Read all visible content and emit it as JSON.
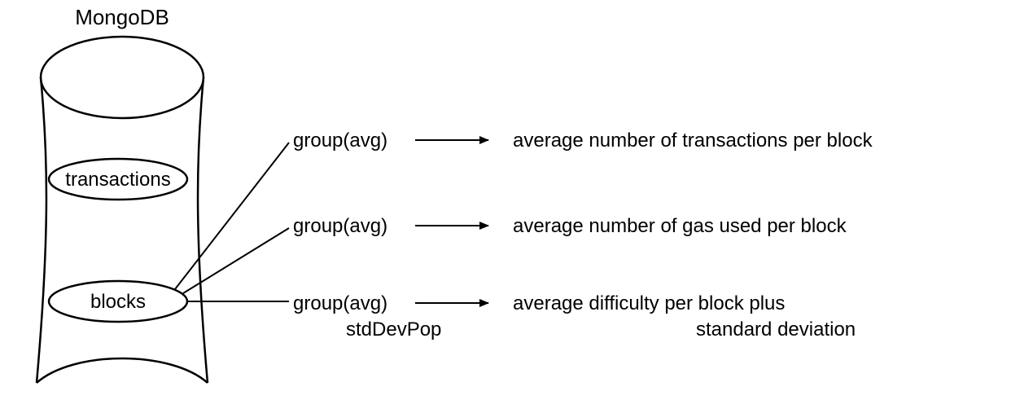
{
  "title": "MongoDB",
  "db": {
    "collections": {
      "transactions": "transactions",
      "blocks": "blocks"
    }
  },
  "operations": [
    {
      "name": "group(avg)",
      "sub": "",
      "result": "average number of transactions per block",
      "result2": ""
    },
    {
      "name": "group(avg)",
      "sub": "",
      "result": "average number of gas used per block",
      "result2": ""
    },
    {
      "name": "group(avg)",
      "sub": "stdDevPop",
      "result": "average difficulty per block plus",
      "result2": "standard deviation"
    }
  ]
}
